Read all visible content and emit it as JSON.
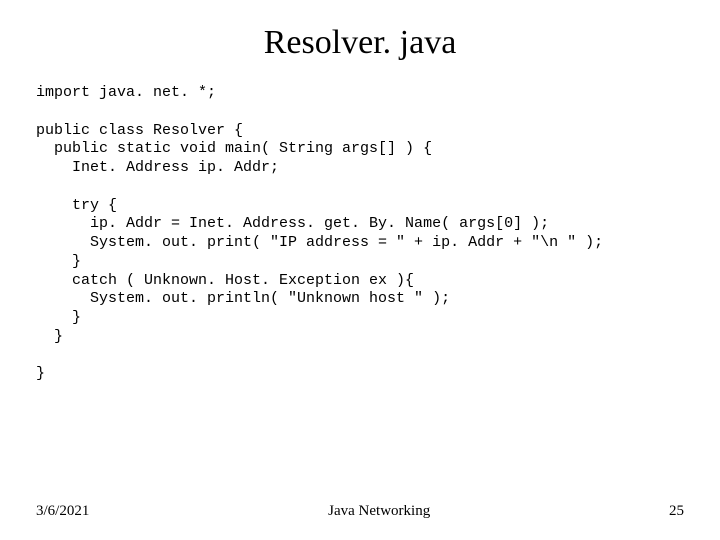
{
  "title": "Resolver. java",
  "code_lines": [
    "import java. net. *;",
    "",
    "public class Resolver {",
    "  public static void main( String args[] ) {",
    "    Inet. Address ip. Addr;",
    "",
    "    try {",
    "      ip. Addr = Inet. Address. get. By. Name( args[0] );",
    "      System. out. print( \"IP address = \" + ip. Addr + \"\\n \" );",
    "    }",
    "    catch ( Unknown. Host. Exception ex ){",
    "      System. out. println( \"Unknown host \" );",
    "    }",
    "  }",
    "",
    "}"
  ],
  "footer": {
    "date": "3/6/2021",
    "center": "Java Networking",
    "page": "25"
  }
}
